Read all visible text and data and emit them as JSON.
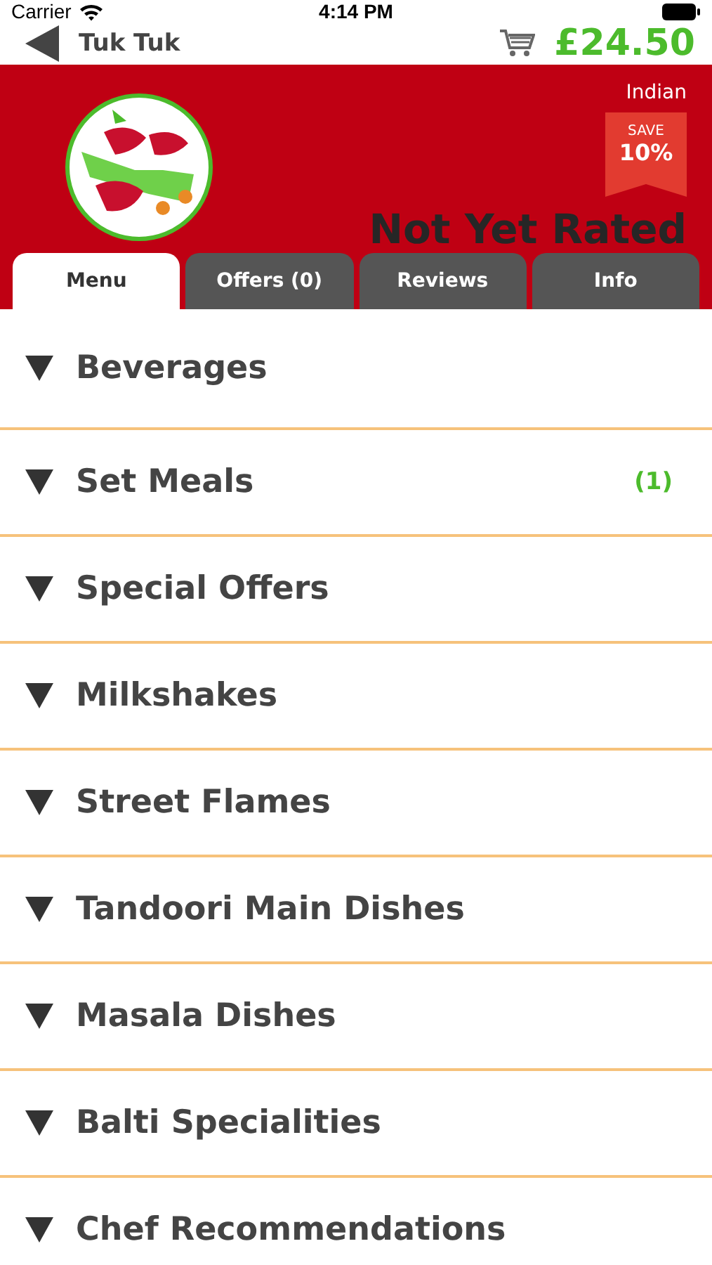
{
  "status_bar": {
    "carrier": "Carrier",
    "time": "4:14 PM"
  },
  "nav": {
    "title": "Tuk Tuk",
    "basket_total": "£24.50"
  },
  "header": {
    "cuisine": "Indian",
    "save_label": "SAVE",
    "save_amount": "10%",
    "rating": "Not Yet Rated"
  },
  "tabs": [
    {
      "label": "Menu",
      "selected": true
    },
    {
      "label": "Offers (0)",
      "selected": false
    },
    {
      "label": "Reviews",
      "selected": false
    },
    {
      "label": "Info",
      "selected": false
    }
  ],
  "categories": [
    {
      "name": "Beverages",
      "expanded": false
    },
    {
      "name": "Set Meals",
      "count": "(1)",
      "expanded": false
    },
    {
      "name": "Special Offers",
      "expanded": false
    },
    {
      "name": "Milkshakes",
      "expanded": false
    },
    {
      "name": "Street Flames",
      "expanded": false
    },
    {
      "name": "Tandoori Main Dishes",
      "expanded": false
    },
    {
      "name": "Masala Dishes",
      "expanded": false
    },
    {
      "name": "Balti Specialities",
      "expanded": false
    },
    {
      "name": "Chef Recommendations",
      "expanded": false
    }
  ]
}
